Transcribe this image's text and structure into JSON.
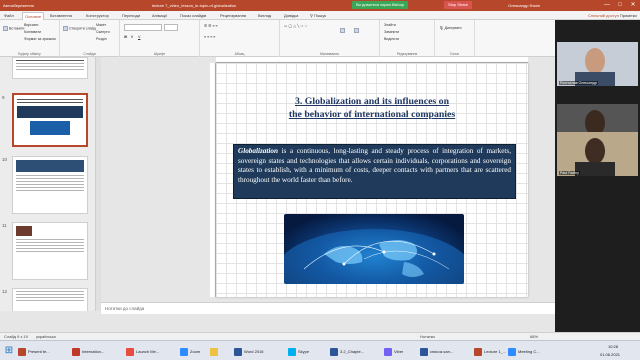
{
  "titlebar": {
    "autosave": "Автозбереження",
    "filename": "lecture 7_video_lesson_in-topic-of-globalization",
    "zoom_status": "Ви дивитеся екран Bishop",
    "zoom_stop": "Stop Share",
    "user": "Олександр Фалін",
    "minimize": "—",
    "maximize": "□",
    "close": "✕"
  },
  "tabs": [
    "Файл",
    "Основне",
    "Вставлення",
    "Конструктор",
    "Переходи",
    "Анімації",
    "Показ слайдів",
    "Рецензування",
    "Вигляд",
    "Довідка"
  ],
  "tab_search": "Пошук",
  "share_label": "Спільний доступ",
  "comments_label": "Примітки",
  "ribbon_groups": [
    "Буфер обміну",
    "Слайди",
    "Шрифт",
    "Абзац",
    "Малювання",
    "Редагування",
    "Голос"
  ],
  "ribbon_items": {
    "paste": "Вставити",
    "cut": "Вирізати",
    "copy": "Копіювати",
    "format_painter": "Формат за зразком",
    "new_slide": "Створити слайд",
    "layout": "Макет",
    "reset": "Скинути",
    "section": "Розділ",
    "find": "Знайти",
    "replace": "Замінити",
    "select": "Виділити",
    "dictate": "Диктувати"
  },
  "thumbnails": [
    {
      "num": "9"
    },
    {
      "num": "10"
    },
    {
      "num": "11"
    },
    {
      "num": "12"
    }
  ],
  "slide": {
    "title_line1": "3. Globalization and its influences on",
    "title_line2": "the behavior of international companies",
    "body_bold": "Globalization",
    "body_rest": " is a continuous, long-lasting and steady process of integration of markets, sovereign states and technologies that allows certain individuals, corporations and sovereign states to establish, with a minimum of costs, deeper contacts with partners that are scattered throughout the world faster than before."
  },
  "notes_placeholder": "Нотатки до слайда",
  "status": {
    "slide_counter": "Слайд 9 з 19",
    "language": "українська",
    "notes_btn": "Нотатки",
    "zoom": "68%"
  },
  "taskbar": {
    "apps": [
      "Present te...",
      "Internation...",
      "Launch Me...",
      "Zoom",
      "",
      "Word 2016",
      "Skype",
      "3.2_Chapte...",
      "Viber",
      "список кан...",
      "Lecture 1_...",
      "Meeting C..."
    ],
    "time": "10:28",
    "date": "01.06.2021"
  },
  "participants": [
    {
      "name": "Ростислав Олександр"
    },
    {
      "name": "Jean Afrim"
    },
    {
      "name": "Paul Fadiny"
    }
  ]
}
